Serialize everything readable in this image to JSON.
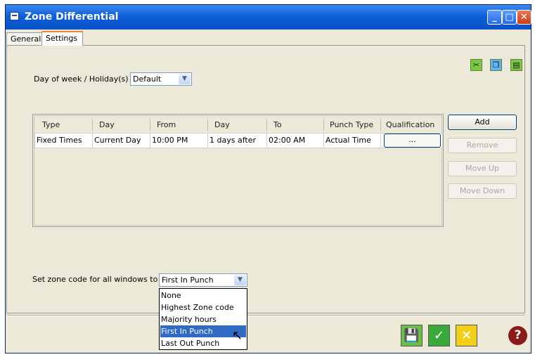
{
  "window": {
    "title": "Zone Differential"
  },
  "tabs": [
    {
      "label": "General"
    },
    {
      "label": "Settings"
    }
  ],
  "toolbar": {
    "icons": [
      "cut-icon",
      "copy-icon",
      "paste-icon"
    ]
  },
  "day_selector": {
    "label": "Day of week / Holiday(s)",
    "value": "Default"
  },
  "grid": {
    "columns": [
      "Type",
      "Day",
      "From",
      "Day",
      "To",
      "Punch Type",
      "Qualification"
    ],
    "rows": [
      {
        "type": "Fixed Times",
        "day": "Current Day",
        "from": "10:00 PM",
        "day2": "1 days after",
        "to": "02:00 AM",
        "punch_type": "Actual Time",
        "qualification": "..."
      }
    ]
  },
  "buttons": {
    "add": "Add",
    "remove": "Remove",
    "move_up": "Move Up",
    "move_down": "Move Down"
  },
  "zone_code": {
    "label": "Set zone code for all windows to",
    "value": "First In Punch",
    "options": [
      "None",
      "Highest Zone code",
      "Majority hours",
      "First In Punch",
      "Last Out Punch"
    ],
    "highlighted": "First In Punch"
  },
  "bottom_buttons": [
    "save-as-icon",
    "ok-check-icon",
    "cancel-x-icon",
    "help-icon"
  ],
  "colors": {
    "titlebar": "#0852c7",
    "selection": "#316ac5",
    "tab_accent": "#e68b2c",
    "ok": "#3aa93a",
    "cancel": "#f2d019"
  }
}
